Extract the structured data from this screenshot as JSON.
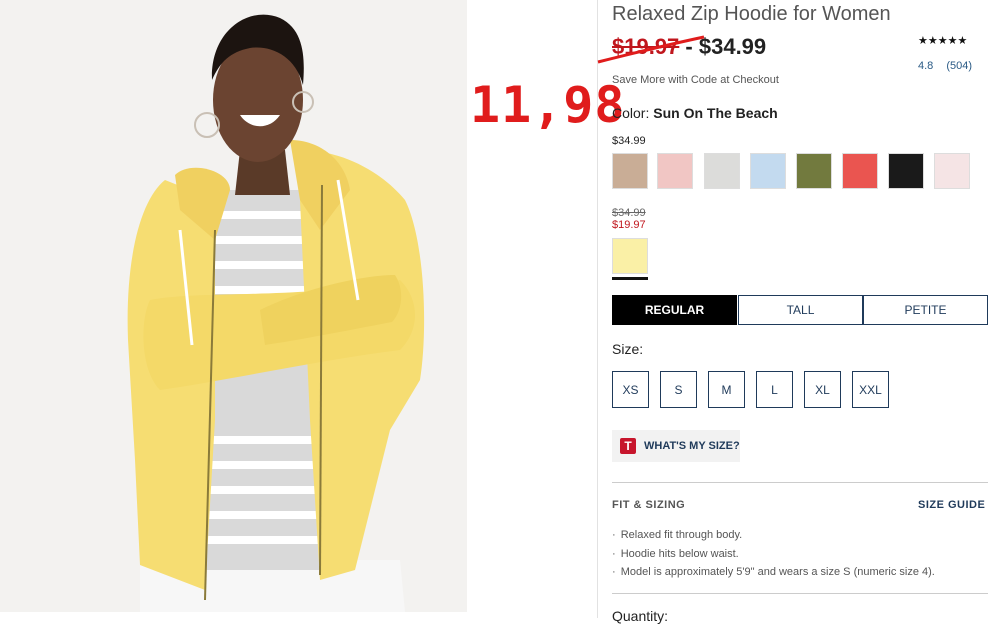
{
  "annotation": {
    "handwritten_price": "11,98"
  },
  "product": {
    "title": "Relaxed Zip Hoodie for Women",
    "old_price": "$19.97",
    "price_separator": " - ",
    "price": "$34.99",
    "stars": "★★★★★",
    "rating": "4.8",
    "review_count": "(504)",
    "promo": "Save More with Code at Checkout"
  },
  "color": {
    "label": "Color: ",
    "selected": "Sun On The Beach",
    "regular_price": "$34.99",
    "swatches": [
      {
        "name": "tan",
        "hex": "#c9ad96"
      },
      {
        "name": "light-pink",
        "hex": "#f1c6c4"
      },
      {
        "name": "light-gray",
        "hex": "#dcdcda"
      },
      {
        "name": "light-blue",
        "hex": "#c3daef"
      },
      {
        "name": "olive",
        "hex": "#727a3e"
      },
      {
        "name": "coral-red",
        "hex": "#ea5550"
      },
      {
        "name": "black",
        "hex": "#1a1a1a"
      },
      {
        "name": "pale-pink",
        "hex": "#f5e4e5"
      }
    ],
    "sale_old_price": "$34.99",
    "sale_price": "$19.97",
    "sale_swatch": {
      "name": "yellow",
      "hex": "#faf0a6"
    }
  },
  "fit_tabs": [
    {
      "label": "REGULAR",
      "active": true
    },
    {
      "label": "TALL",
      "active": false
    },
    {
      "label": "PETITE",
      "active": false
    }
  ],
  "sizes": {
    "label": "Size:",
    "options": [
      "XS",
      "S",
      "M",
      "L",
      "XL",
      "XXL"
    ]
  },
  "whats_my_size": {
    "icon_letter": "T",
    "label": "WHAT'S MY SIZE?"
  },
  "fit_sizing": {
    "heading": "FIT & SIZING",
    "guide_link": "SIZE GUIDE",
    "bullets": [
      "Relaxed fit through body.",
      "Hoodie hits below waist.",
      "Model is approximately 5'9\" and wears a size S (numeric size 4)."
    ]
  },
  "quantity_label": "Quantity:",
  "colors": {
    "accent_red": "#c0161d",
    "navy": "#1f3a5a",
    "annotation_red": "#e01c1c"
  }
}
